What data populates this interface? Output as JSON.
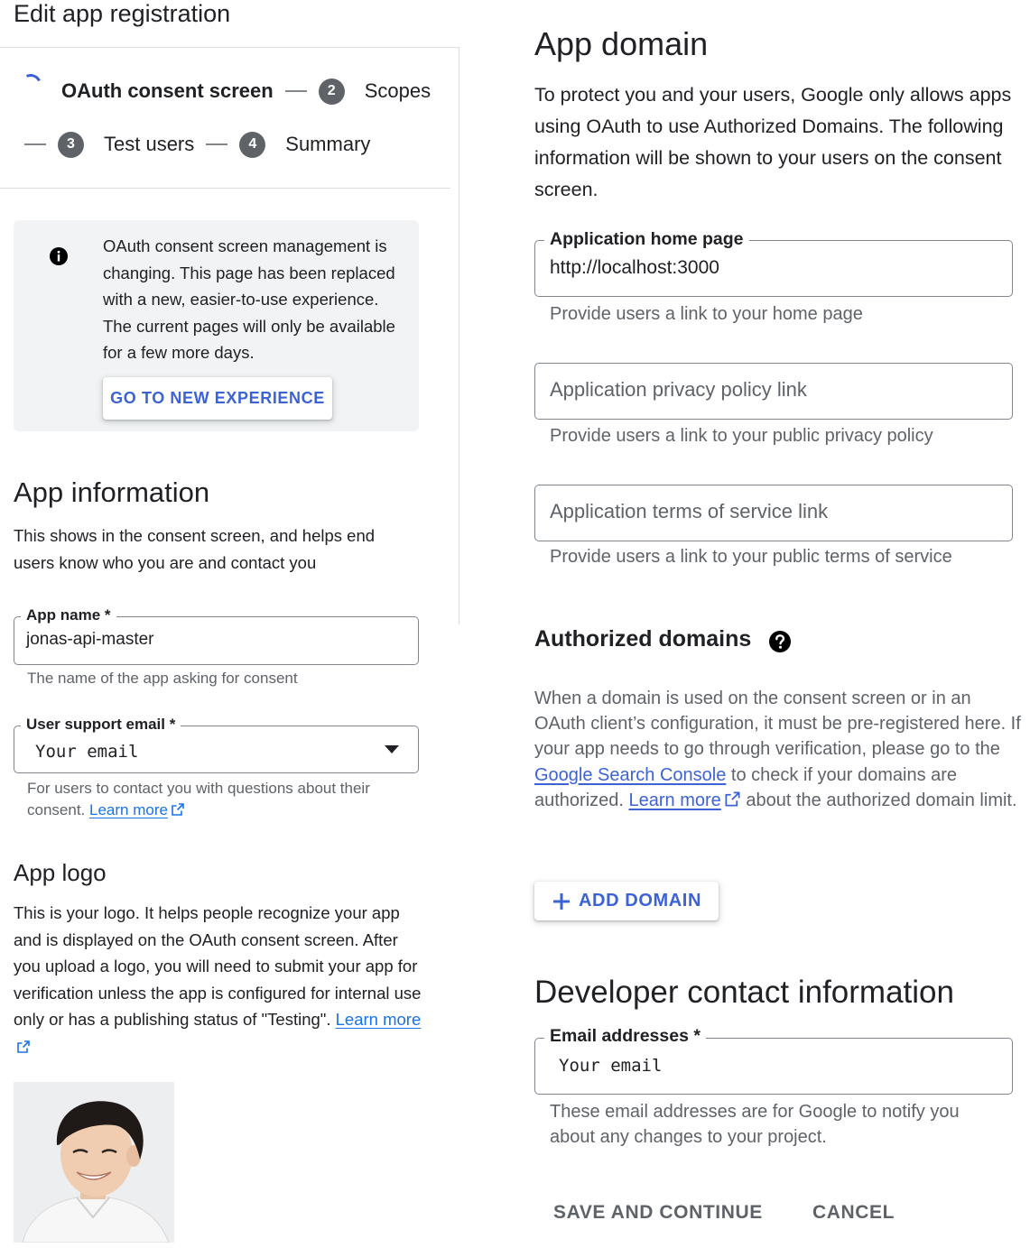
{
  "page": {
    "title": "Edit app registration"
  },
  "stepper": {
    "steps": [
      {
        "label": "OAuth consent screen",
        "state": "in-progress"
      },
      {
        "number": "2",
        "label": "Scopes"
      },
      {
        "number": "3",
        "label": "Test users"
      },
      {
        "number": "4",
        "label": "Summary"
      }
    ]
  },
  "notice": {
    "text": "OAuth consent screen management is changing. This page has been replaced with a new, easier-to-use experience. The current pages will only be available for a few more days.",
    "button_label": "GO TO NEW EXPERIENCE"
  },
  "app_information": {
    "title": "App information",
    "description": "This shows in the consent screen, and helps end users know who you are and contact you",
    "app_name": {
      "label": "App name *",
      "value": "jonas-api-master",
      "hint": "The name of the app asking for consent"
    },
    "support_email": {
      "label": "User support email *",
      "value": "Your email",
      "hint": "For users to contact you with questions about their consent.",
      "link": "Learn more"
    }
  },
  "app_logo": {
    "title": "App logo",
    "description": "This is your logo. It helps people recognize your app and is displayed on the OAuth consent screen. After you upload a logo, you will need to submit your app for verification unless the app is configured for internal use only or has a publishing status of \"Testing\".",
    "link": "Learn more"
  },
  "app_domain": {
    "title": "App domain",
    "description": "To protect you and your users, Google only allows apps using OAuth to use Authorized Domains. The following information will be shown to your users on the consent screen.",
    "home_page": {
      "label": "Application home page",
      "value": "http://localhost:3000",
      "hint": "Provide users a link to your home page"
    },
    "privacy_policy": {
      "placeholder": "Application privacy policy link",
      "hint": "Provide users a link to your public privacy policy"
    },
    "terms_of_service": {
      "placeholder": "Application terms of service link",
      "hint": "Provide users a link to your public terms of service"
    }
  },
  "authorized_domains": {
    "title": "Authorized domains",
    "text_1": "When a domain is used on the consent screen or in an OAuth client’s configuration, it must be pre-registered here. If your app needs to go through verification, please go to the ",
    "link_console": "Google Search Console",
    "text_2": " to check if your domains are authorized. ",
    "link_learn": "Learn more",
    "text_3": " about the authorized domain limit.",
    "add_button": "ADD DOMAIN"
  },
  "developer_contact": {
    "title": "Developer contact information",
    "email": {
      "label": "Email addresses *",
      "value": "Your email",
      "hint": "These email addresses are for Google to notify you about any changes to your project."
    }
  },
  "actions": {
    "save": "SAVE AND CONTINUE",
    "cancel": "CANCEL"
  },
  "colors": {
    "accent": "#3c63d6",
    "link": "#1a73e8",
    "notice_bg": "#f1f3f4",
    "text": "#202124",
    "hint": "#5f6368"
  },
  "icons": {
    "info": "info-icon",
    "help": "help-icon",
    "external_link": "external-link-icon",
    "plus": "plus-icon",
    "dropdown": "chevron-down-icon",
    "spinner": "spinner-icon"
  }
}
